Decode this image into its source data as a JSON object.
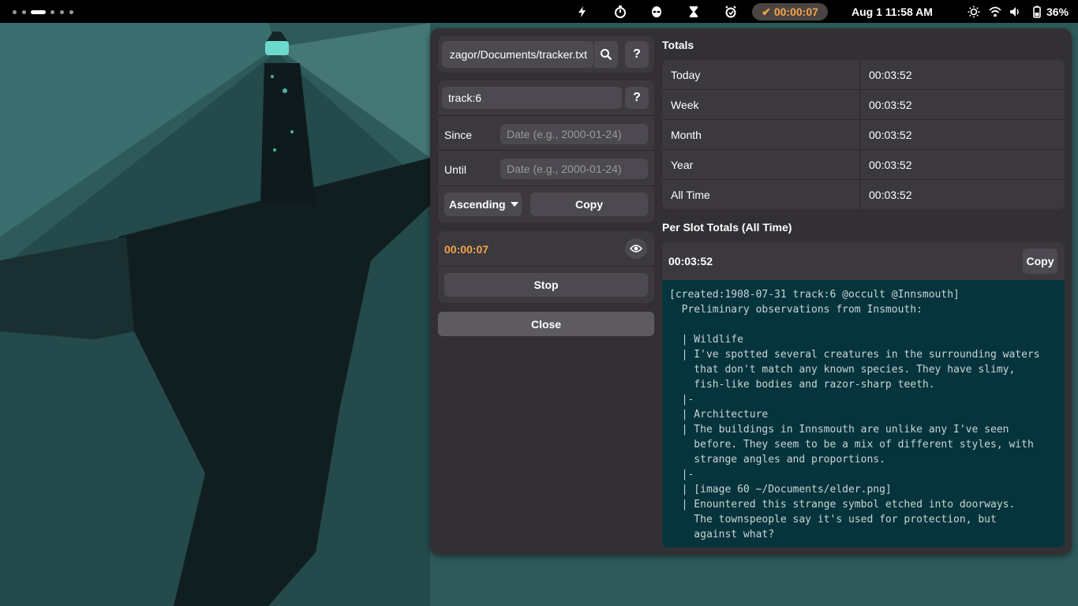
{
  "topbar": {
    "workspaces": [
      {
        "active": false
      },
      {
        "active": false
      },
      {
        "active": true
      },
      {
        "active": false
      },
      {
        "active": false
      },
      {
        "active": false
      }
    ],
    "indicators": [
      "bolt-icon",
      "stopwatch-icon",
      "alien-icon",
      "hourglass-icon",
      "alarm-icon"
    ],
    "timer_pill": {
      "check": "✔",
      "time": "00:00:07",
      "color": "#f6a346"
    },
    "clock": "Aug 1  11:58 AM",
    "status": [
      "brightness-icon",
      "wifi-icon",
      "volume-icon",
      "battery-icon"
    ],
    "battery_percent": "36%"
  },
  "left": {
    "file_path": "zagor/Documents/tracker.txt",
    "search_help": "?",
    "filter_query": "track:6",
    "filter_help": "?",
    "since_label": "Since",
    "since_placeholder": "Date (e.g., 2000-01-24)",
    "until_label": "Until",
    "until_placeholder": "Date (e.g., 2000-01-24)",
    "sort_label": "Ascending",
    "copy_label": "Copy",
    "timer_value": "00:00:07",
    "stop_label": "Stop",
    "close_label": "Close"
  },
  "totals": {
    "title": "Totals",
    "rows": [
      {
        "name": "Today",
        "value": "00:03:52"
      },
      {
        "name": "Week",
        "value": "00:03:52"
      },
      {
        "name": "Month",
        "value": "00:03:52"
      },
      {
        "name": "Year",
        "value": "00:03:52"
      },
      {
        "name": "All Time",
        "value": "00:03:52"
      }
    ]
  },
  "slots": {
    "title": "Per Slot Totals (All Time)",
    "total": "00:03:52",
    "copy_label": "Copy",
    "text": "[created:1908-07-31 track:6 @occult @Innsmouth]\n  Preliminary observations from Insmouth:\n\n  | Wildlife\n  | I've spotted several creatures in the surrounding waters\n    that don't match any known species. They have slimy,\n    fish-like bodies and razor-sharp teeth.\n  |-\n  | Architecture\n  | The buildings in Innsmouth are unlike any I've seen\n    before. They seem to be a mix of different styles, with\n    strange angles and proportions.\n  |-\n  | [image 60 ~/Documents/elder.png]\n  | Enountered this strange symbol etched into doorways.\n    The townspeople say it's used for protection, but\n    against what?"
  },
  "colors": {
    "accent": "#f6a346",
    "panel": "#323034",
    "text_area": "#06343c"
  }
}
